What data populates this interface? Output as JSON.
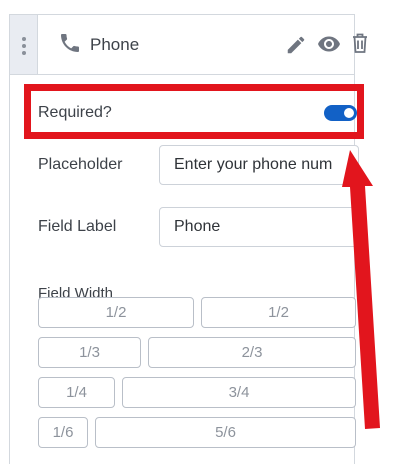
{
  "header": {
    "title": "Phone",
    "icons": {
      "drag": "drag-handle-icon",
      "phone": "phone-icon",
      "edit": "pencil-icon",
      "preview": "eye-icon",
      "delete": "trash-icon"
    }
  },
  "settings": {
    "required_label": "Required?",
    "required_enabled": true,
    "placeholder_label": "Placeholder",
    "placeholder_value": "Enter your phone num",
    "field_label_label": "Field Label",
    "field_label_value": "Phone",
    "field_width_label": "Field Width",
    "width_options": [
      [
        "1/2",
        "1/2"
      ],
      [
        "1/3",
        "2/3"
      ],
      [
        "1/4",
        "3/4"
      ],
      [
        "1/6",
        "5/6"
      ]
    ]
  },
  "colors": {
    "toggle_on": "#1261c6",
    "annotation": "#e2151d",
    "header_handle": "#e9ecf2",
    "border": "#d3d8de"
  }
}
